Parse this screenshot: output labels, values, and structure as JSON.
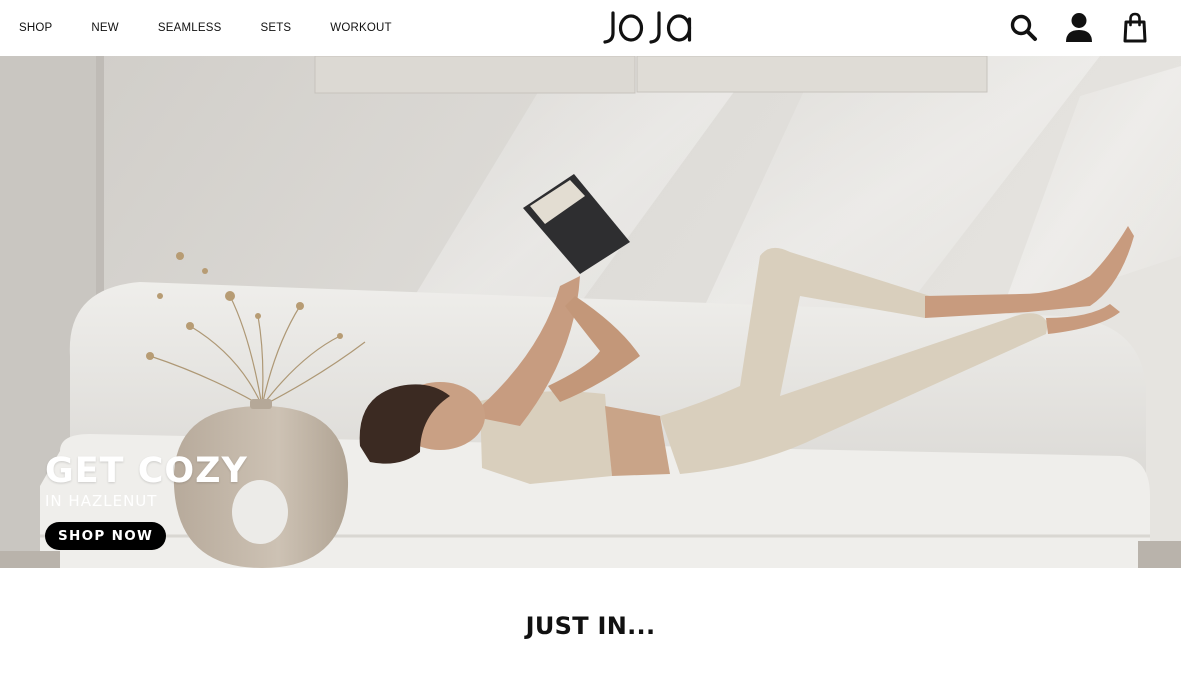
{
  "nav": {
    "items": [
      "SHOP",
      "NEW",
      "SEAMLESS",
      "SETS",
      "WORKOUT"
    ]
  },
  "brand": {
    "logo_text": "joja"
  },
  "header_icons": [
    "search-icon",
    "account-icon",
    "shopping-bag-icon"
  ],
  "hero": {
    "title": "GET COZY",
    "subtitle": "IN HAZLENUT",
    "cta_label": "SHOP NOW"
  },
  "section": {
    "title": "JUST IN..."
  },
  "colors": {
    "text": "#111111",
    "button_bg": "#000000",
    "button_text": "#ffffff",
    "hero_wall": "#d6d4d0",
    "outfit": "#d9cfbd",
    "sofa": "#ecebe8"
  }
}
